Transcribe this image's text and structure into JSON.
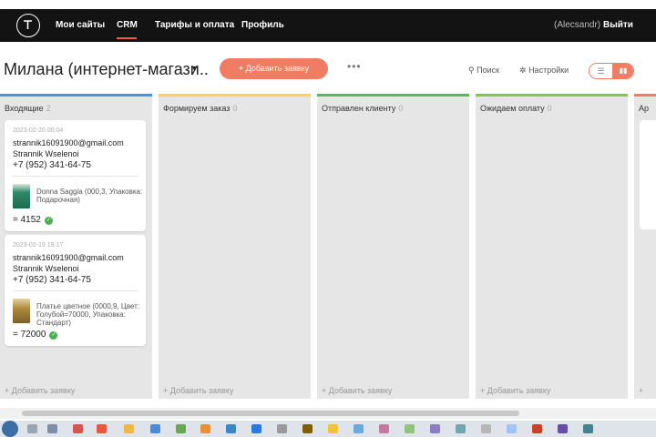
{
  "nav": {
    "items": [
      "Мои сайты",
      "CRM",
      "Тарифы и оплата",
      "Профиль"
    ],
    "active": "CRM",
    "user": "(Alecsandr)",
    "logout": "Выйти"
  },
  "header": {
    "title": "Милана (интернет-магази..",
    "add_button": "+  Добавить заявку",
    "more": "•••",
    "search": "Поиск",
    "settings": "Настройки"
  },
  "columns": [
    {
      "title": "Входящие",
      "count": "2",
      "accent": "#4a90e2",
      "add": "+ Добавить заявку"
    },
    {
      "title": "Формируем заказ",
      "count": "0",
      "accent": "#f2d45c",
      "add": "+ Добавить заявку"
    },
    {
      "title": "Отправлен клиенту",
      "count": "0",
      "accent": "#5cb85c",
      "add": "+ Добавить заявку"
    },
    {
      "title": "Ожидаем оплату",
      "count": "0",
      "accent": "#8bc34a",
      "add": "+ Добавить заявку"
    },
    {
      "title": "Ар",
      "count": "",
      "accent": "#f07c63",
      "add": "+"
    }
  ],
  "cards": [
    {
      "date": "2023-02-20 00:04",
      "email": "strannik16091900@gmail.com",
      "name": "Strannik Wselenoi",
      "phone": "+7 (952) 341-64-75",
      "product": "Donna Saggia (000,3, Упаковка: Подарочная)",
      "price": "= 4152",
      "thumb_color": "#2f8a6a"
    },
    {
      "date": "2023-02-19 19:17",
      "email": "strannik16091900@gmail.com",
      "name": "Strannik Wselenoi",
      "phone": "+7 (952) 341-64-75",
      "product": "Платье цветное (0000,9, Цвет: Голубой=70000, Упаковка: Стандарт)",
      "price": "= 72000",
      "thumb_color": "#b08a3a"
    }
  ],
  "colors": {
    "accent": "#f07c63",
    "topbar": "#131313",
    "column_bg": "#e6e6e6",
    "success": "#4caf50"
  }
}
